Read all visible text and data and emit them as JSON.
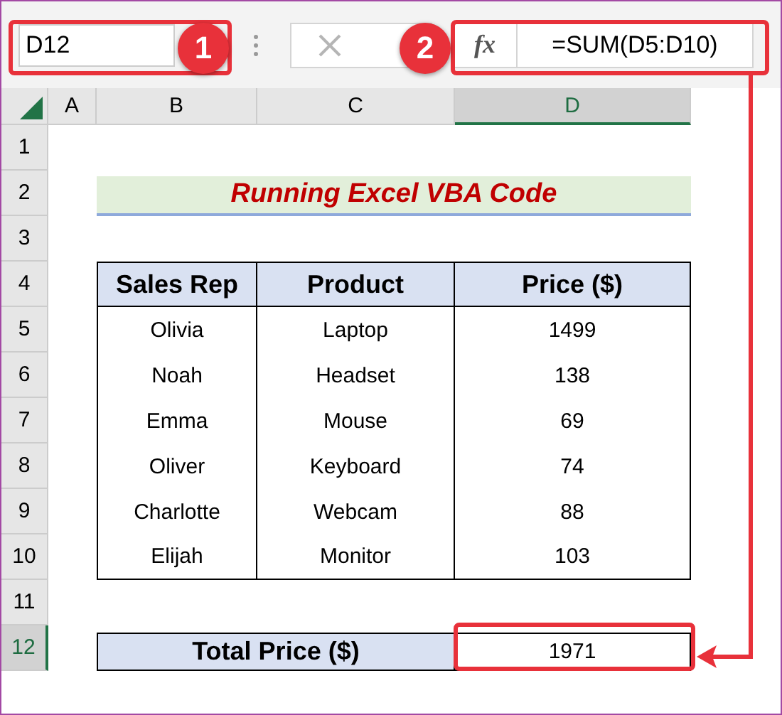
{
  "formula_bar": {
    "name_box": "D12",
    "fx": "fx",
    "formula": "=SUM(D5:D10)"
  },
  "callouts": [
    "1",
    "2"
  ],
  "columns": [
    {
      "label": "A",
      "selected": false
    },
    {
      "label": "B",
      "selected": false
    },
    {
      "label": "C",
      "selected": false
    },
    {
      "label": "D",
      "selected": true
    }
  ],
  "rows": [
    {
      "label": "1",
      "selected": false
    },
    {
      "label": "2",
      "selected": false
    },
    {
      "label": "3",
      "selected": false
    },
    {
      "label": "4",
      "selected": false
    },
    {
      "label": "5",
      "selected": false
    },
    {
      "label": "6",
      "selected": false
    },
    {
      "label": "7",
      "selected": false
    },
    {
      "label": "8",
      "selected": false
    },
    {
      "label": "9",
      "selected": false
    },
    {
      "label": "10",
      "selected": false
    },
    {
      "label": "11",
      "selected": false
    },
    {
      "label": "12",
      "selected": true
    }
  ],
  "title": "Running Excel VBA Code",
  "table": {
    "columns": [
      "Sales Rep",
      "Product",
      "Price ($)"
    ],
    "rows": [
      [
        "Olivia",
        "Laptop",
        "1499"
      ],
      [
        "Noah",
        "Headset",
        "138"
      ],
      [
        "Emma",
        "Mouse",
        "69"
      ],
      [
        "Oliver",
        "Keyboard",
        "74"
      ],
      [
        "Charlotte",
        "Webcam",
        "88"
      ],
      [
        "Elijah",
        "Monitor",
        "103"
      ]
    ]
  },
  "total": {
    "label": "Total Price ($)",
    "value": "1971"
  }
}
